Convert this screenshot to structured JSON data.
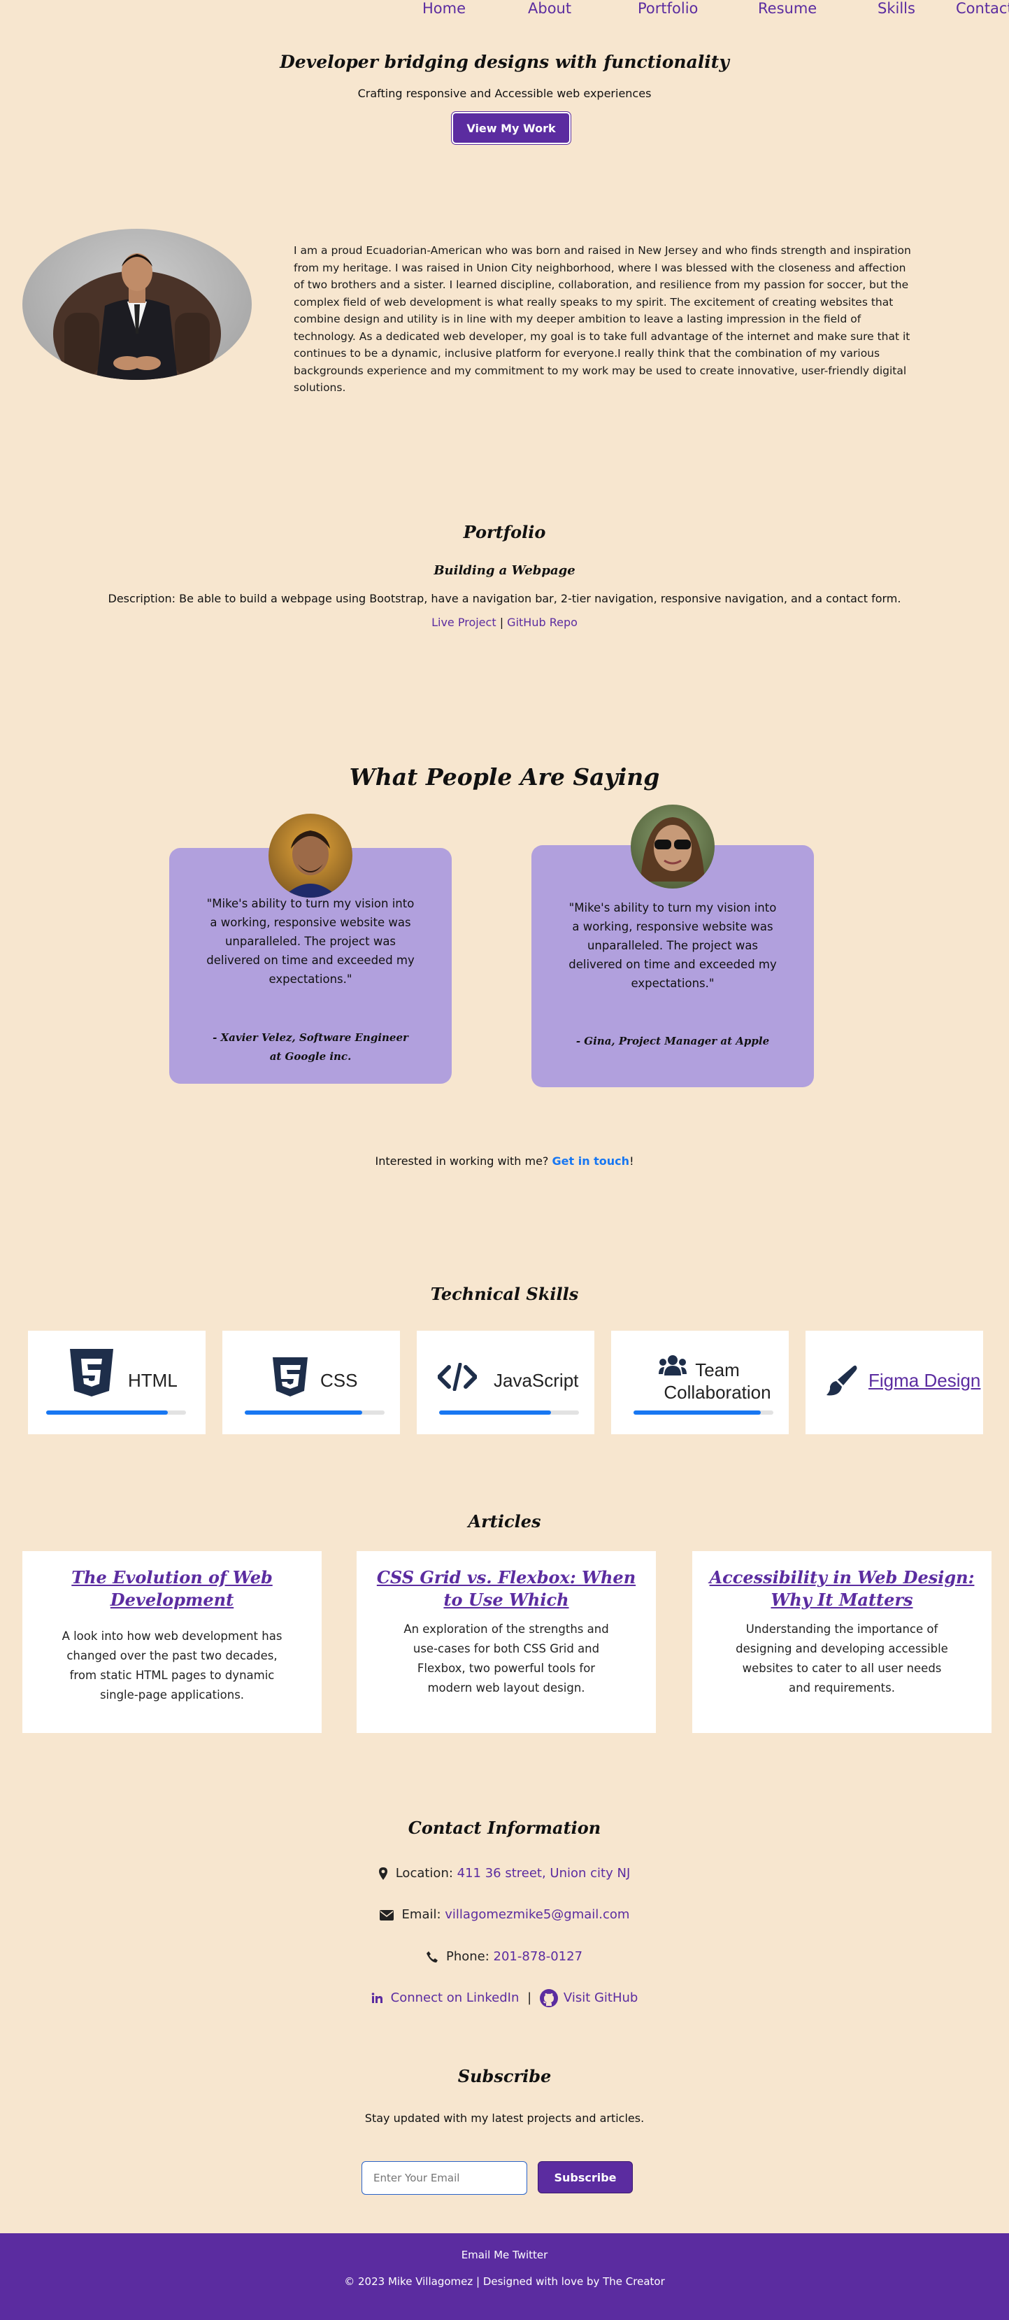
{
  "nav": {
    "items": [
      "Home",
      "About",
      "Portfolio",
      "Resume",
      "Skills",
      "Contact"
    ]
  },
  "hero": {
    "title": "Developer bridging designs with functionality",
    "subtitle": "Crafting responsive and Accessible web experiences",
    "button": "View My Work"
  },
  "about": {
    "text": "I am a proud Ecuadorian-American who was born and raised in New Jersey and who finds strength and inspiration from my heritage. I was raised in Union City neighborhood, where I was blessed with the closeness and affection of two brothers and a sister. I learned discipline, collaboration, and resilience from my passion for soccer, but the complex field of web development is what really speaks to my spirit. The excitement of creating websites that combine design and utility is in line with my deeper ambition to leave a lasting impression in the field of technology. As a dedicated web developer, my goal is to take full advantage of the internet and make sure that it continues to be a dynamic, inclusive platform for everyone.I really think that the combination of my various backgrounds experience and my commitment to my work may be used to create innovative, user-friendly digital solutions."
  },
  "portfolio": {
    "heading": "Portfolio",
    "project_title": "Building a Webpage",
    "description": "Description: Be able to build a webpage using Bootstrap, have a navigation bar, 2-tier navigation, responsive navigation, and a contact form.",
    "live_link": "Live Project",
    "separator": "|",
    "repo_link": "GitHub Repo"
  },
  "testimonials": {
    "heading": "What People Are Saying",
    "items": [
      {
        "quote": "\"Mike's ability to turn my vision into a working, responsive website was unparalleled. The project was delivered on time and exceeded my expectations.\"",
        "author": "- Xavier Velez, Software Engineer at Google inc."
      },
      {
        "quote": "\"Mike's ability to turn my vision into a working, responsive website was unparalleled. The project was delivered on time and exceeded my expectations.\"",
        "author": "- Gina, Project Manager at Apple"
      }
    ],
    "cta_text": "Interested in working with me? ",
    "cta_link": "Get in touch",
    "cta_end": "!"
  },
  "skills": {
    "heading": "Technical Skills",
    "items": [
      {
        "label": "HTML",
        "icon": "html5-icon",
        "level": 0.87
      },
      {
        "label": "CSS",
        "icon": "css3-icon",
        "level": 0.84
      },
      {
        "label": "JavaScript",
        "icon": "code-icon",
        "level": 0.8
      },
      {
        "label": "Team Collaboration",
        "icon": "users-icon",
        "level": 0.91
      },
      {
        "label": "Figma Design",
        "icon": "paintbrush-icon"
      }
    ]
  },
  "articles": {
    "heading": "Articles",
    "items": [
      {
        "title": "The Evolution of Web Development",
        "desc": "A look into how web development has changed over the past two decades, from static HTML pages to dynamic single-page applications."
      },
      {
        "title": "CSS Grid vs. Flexbox: When to Use Which",
        "desc": "An exploration of the strengths and use-cases for both CSS Grid and Flexbox, two powerful tools for modern web layout design."
      },
      {
        "title": "Accessibility in Web Design: Why It Matters",
        "desc": "Understanding the importance of designing and developing accessible websites to cater to all user needs and requirements."
      }
    ]
  },
  "contact": {
    "heading": "Contact Information",
    "location_label": "Location: ",
    "location": "411 36 street, Union city NJ",
    "email_label": "Email: ",
    "email": "villagomezmike5@gmail.com",
    "phone_label": "Phone: ",
    "phone": "201-878-0127",
    "linkedin": "Connect on LinkedIn",
    "sep": "|",
    "github": "Visit GitHub"
  },
  "subscribe": {
    "heading": "Subscribe",
    "text": "Stay updated with my latest projects and articles.",
    "placeholder": "Enter Your Email",
    "button": "Subscribe"
  },
  "footer": {
    "links": "Email Me Twitter",
    "copyright": "© 2023 Mike Villagomez | Designed with love by The Creator"
  },
  "colors": {
    "accent": "#5b2ca0",
    "background": "#f7e6cf",
    "card": "#b1a0dd",
    "bar": "#1877f2"
  }
}
